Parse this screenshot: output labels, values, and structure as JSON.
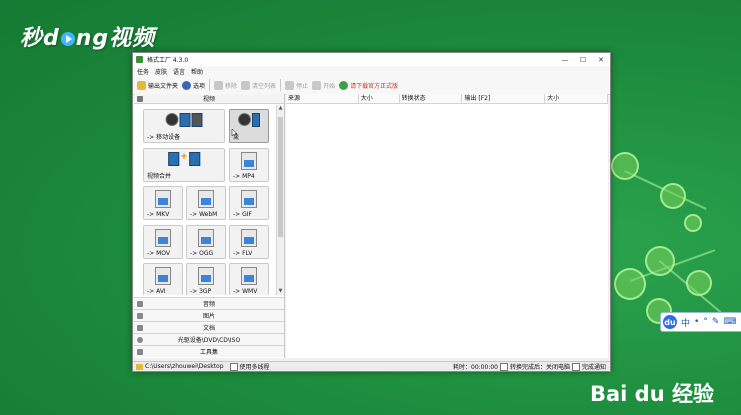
{
  "watermark": {
    "brand": "秒懂视频",
    "brand_prefix": "秒d",
    "brand_suffix": "ng视频",
    "baidu": "Bai du 经验"
  },
  "window": {
    "title": "格式工厂 4.3.0",
    "controls": [
      "—",
      "☐",
      "✕"
    ]
  },
  "menu": [
    "任务",
    "皮肤",
    "语言",
    "帮助"
  ],
  "toolbar": {
    "output_folder": "输出文件夹",
    "options": "选项",
    "remove": "移除",
    "clear_list": "清空列表",
    "stop": "停止",
    "start": "开始",
    "download": "请下载官方正式版"
  },
  "left": {
    "video_header": "视频",
    "tiles": [
      {
        "label": "-> 移动设备"
      },
      {
        "label": "流"
      },
      {
        "label": "视频合并"
      },
      {
        "label": "-> MP4"
      },
      {
        "label": "-> MKV"
      },
      {
        "label": "-> WebM"
      },
      {
        "label": "-> GIF"
      },
      {
        "label": "-> MOV"
      },
      {
        "label": "-> OGG"
      },
      {
        "label": "-> FLV"
      },
      {
        "label": "-> AVI"
      },
      {
        "label": "-> 3GP"
      },
      {
        "label": "-> WMV"
      }
    ],
    "categories": [
      "音频",
      "图片",
      "文档",
      "光驱设备\\DVD\\CD\\ISO",
      "工具集"
    ]
  },
  "table": {
    "columns": [
      "来源",
      "大小",
      "转换状态",
      "输出 [F2]",
      "大小"
    ]
  },
  "status": {
    "path": "C:\\Users\\zhouwei\\Desktop",
    "multithread": "使用多线程",
    "elapsed": "耗时：00:00:00",
    "shutdown_after": "转换完成后：关闭电脑",
    "notify": "完成通知"
  },
  "ime": {
    "logo": "du",
    "items": [
      "中",
      "•",
      "°",
      "✎",
      "⌨"
    ]
  }
}
